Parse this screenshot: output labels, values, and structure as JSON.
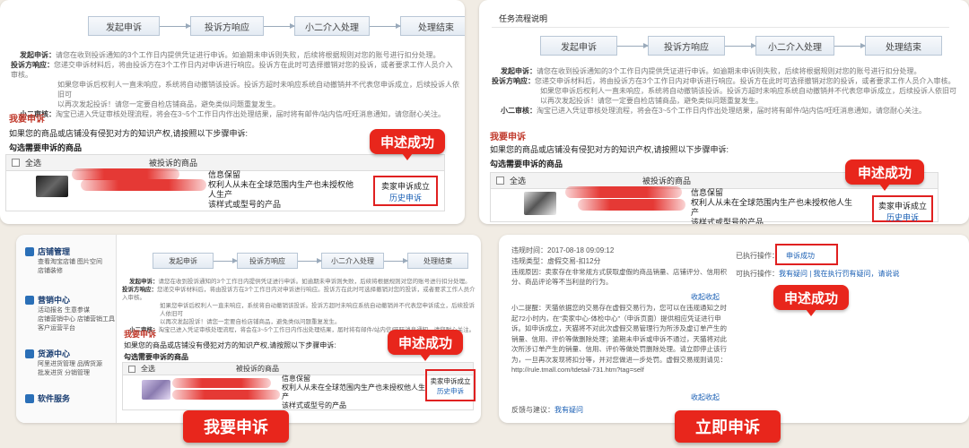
{
  "steps": [
    "发起申诉",
    "投诉方响应",
    "小二介入处理",
    "处理结束"
  ],
  "desc": {
    "initiate_label": "发起申诉：",
    "initiate_text": "请您在收到投诉通知的3个工作日内提供凭证进行申诉。如逾期未申诉则失败，后续将根据规则对您的账号进行扣分处理。",
    "respond_label": "投诉方响应：",
    "respond_text_1": "您递交申诉材料后，将由投诉方在3个工作日内对申诉进行响应。投诉方在此时可选择撤销对您的投诉，或者要求工作人员介入审核。",
    "respond_text_2": "如果您申诉后权利人一直未响应，系统将自动撤销该投诉。投诉方超时未响应系统自动撤销并不代表您申诉成立，后续投诉人依旧可",
    "respond_text_3": "以再次发起投诉！请您一定要自检店铺商品，避免类似问题重复发生。",
    "xiaoer_label": "小二审核：",
    "xiaoer_text": "淘宝已进入凭证审核处理流程，将会在3~5个工作日内作出处理结果，届时将有邮件/站内信/旺旺消息通知，请您耐心关注。"
  },
  "task_flow_title": "任务流程说明",
  "complaint": {
    "section_title": "我要申诉",
    "intro": "如果您的商品或店铺没有侵犯对方的知识产权,请按照以下步骤申诉:",
    "select_label": "勾选需要申诉的商品",
    "select_all": "全选",
    "col_goods": "被投诉的商品",
    "product_line1": "信息保留",
    "product_line2": "权利人从未在全球范围内生产也未授权他人生产",
    "product_line3": "该样式或型号的产品",
    "action_line1": "卖家申诉成立",
    "action_line2": "历史申诉"
  },
  "sidebar": {
    "groups": [
      {
        "title": "店铺管理",
        "items": [
          "查看淘宝店铺",
          "图片空间",
          "店铺装修"
        ]
      },
      {
        "title": "营销中心",
        "items": [
          "活动报名",
          "生意参谋",
          "店铺营销中心",
          "店铺营销工具",
          "客户运营平台"
        ]
      },
      {
        "title": "货源中心",
        "items": [
          "阿里进货管理",
          "品牌货源",
          "批发进货",
          "分销管理"
        ]
      },
      {
        "title": "软件服务",
        "items": []
      }
    ]
  },
  "detail": {
    "violation_time_label": "违规时间：",
    "violation_time": "2017-08-18 09:09:12",
    "violation_type_label": "违规类型：",
    "violation_type": "虚假交易-扣12分",
    "violation_desc_label": "违规原因：",
    "violation_desc": "卖家存在非常规方式获取虚假的商品销量、店铺评分、信用积分、商品评论等不当利益的行为。",
    "collapse": "收起收起",
    "tip_label": "小二提醒：",
    "tip_text": "天猫依据您的交易存在虚假交易行为，您可以在违规通知之时起72小时内，在\"卖家中心-体检中心\"（申诉页面）提供相应凭证进行申诉。如申诉成立，天猫将不对此次虚假交易管理行为所涉及虚订单产生的销量、信用、评价等做删除处理；逾期未申诉或申诉不通过，天猫将对此次所涉订单产生的销量、信用、评价等做处罚删除处理。请立即停止该行为，一旦再次发现将扣分等，并对您做进一步处罚。虚假交易规则请见：http://rule.tmall.com/tdetail-731.htm?tag=self",
    "feedback_label": "反馈与建议：",
    "feedback_link": "我有疑问",
    "executed_label": "已执行操作：",
    "executed_value": "申诉成功",
    "available_label": "可执行操作：",
    "available_value": "我有疑问 | 我在执行罚有疑问，请说说"
  },
  "bubbles": {
    "success": "申述成功"
  },
  "buttons": {
    "complain": "我要申诉",
    "appeal_now": "立即申诉"
  },
  "colors": {
    "accent_red": "#e8261c",
    "link_blue": "#1a5fb4"
  }
}
